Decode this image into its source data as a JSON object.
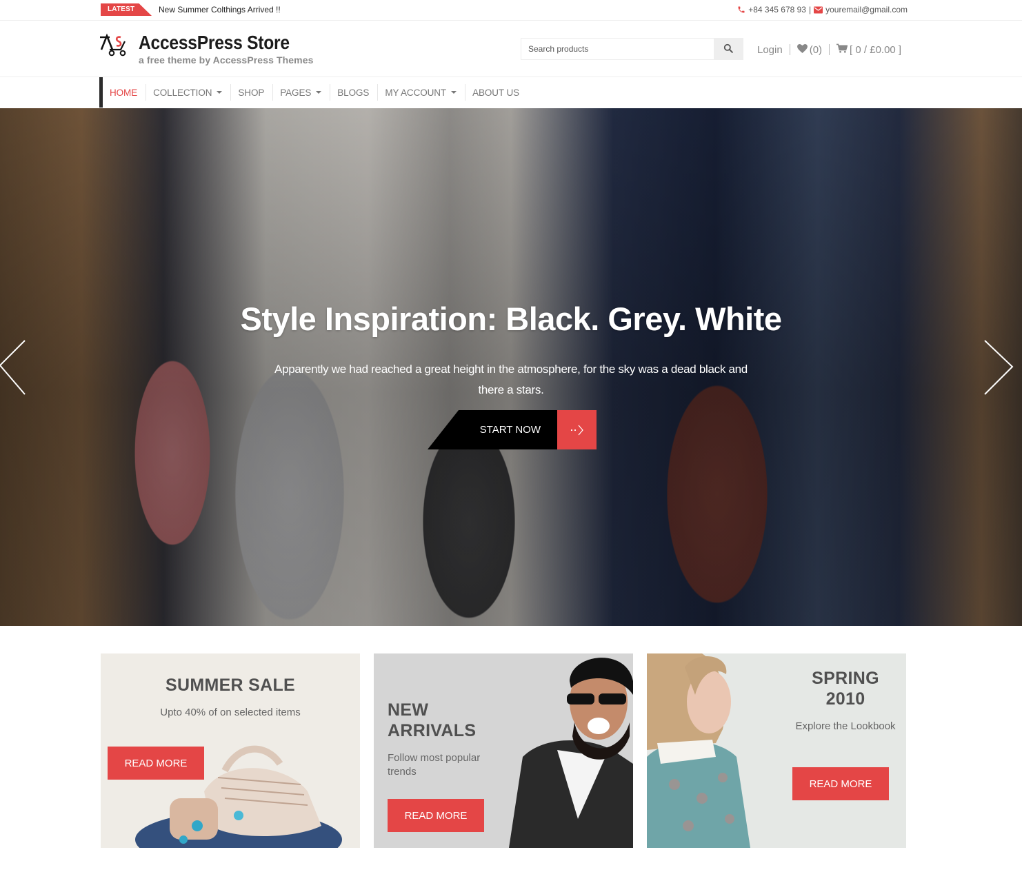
{
  "topbar": {
    "latest_label": "LATEST",
    "latest_text": "New Summer Colthings Arrived !!",
    "phone": "+84 345 678 93",
    "separator": "|",
    "email": "youremail@gmail.com"
  },
  "header": {
    "site_title": "AccessPress Store",
    "tagline": "a free theme by AccessPress Themes",
    "search_placeholder": "Search products",
    "login_label": "Login",
    "wishlist_count": "(0)",
    "cart_summary": "[ 0 / £0.00 ]"
  },
  "nav": {
    "items": [
      {
        "label": "HOME",
        "active": true,
        "has_dropdown": false
      },
      {
        "label": "COLLECTION",
        "active": false,
        "has_dropdown": true
      },
      {
        "label": "SHOP",
        "active": false,
        "has_dropdown": false
      },
      {
        "label": "PAGES",
        "active": false,
        "has_dropdown": true
      },
      {
        "label": "BLOGS",
        "active": false,
        "has_dropdown": false
      },
      {
        "label": "MY ACCOUNT",
        "active": false,
        "has_dropdown": true
      },
      {
        "label": "ABOUT US",
        "active": false,
        "has_dropdown": false
      }
    ]
  },
  "hero": {
    "title": "Style Inspiration: Black. Grey. White",
    "description": "Apparently we had reached a great height in the atmosphere, for the sky was a dead black and there a stars.",
    "cta_label": "START NOW",
    "prev_icon": "chevron-left-icon",
    "next_icon": "chevron-right-icon"
  },
  "promos": [
    {
      "title": "SUMMER SALE",
      "subtitle": "Upto 40% of on selected items",
      "button": "READ MORE"
    },
    {
      "title": "NEW ARRIVALS",
      "subtitle": "Follow most popular trends",
      "button": "READ MORE"
    },
    {
      "title": "SPRING 2010",
      "subtitle": "Explore the Lookbook",
      "button": "READ MORE"
    }
  ],
  "colors": {
    "accent": "#e44646",
    "dark": "#2b2b2b",
    "nav_text": "#777777"
  }
}
